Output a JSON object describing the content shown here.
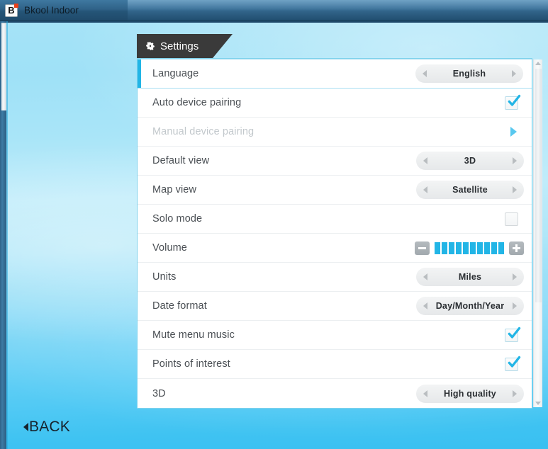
{
  "window": {
    "title": "Bkool Indoor",
    "logo_letter": "B",
    "logo_icon": "bkool-logo-icon"
  },
  "header": {
    "tab_label": "Settings",
    "tab_icon": "gear-icon"
  },
  "colors": {
    "accent_cyan": "#22b5e6",
    "tab_dark": "#3a3a3a",
    "panel_border": "#7fd2ec",
    "label_text": "#4a4f54",
    "disabled_text": "#c2c8cc",
    "sky_top": "#a5e3f7",
    "sky_bottom": "#39c0f1"
  },
  "settings": {
    "rows": [
      {
        "label": "Language",
        "control": "spinner",
        "value": "English",
        "selected": true,
        "disabled": false,
        "name": "setting-row-language"
      },
      {
        "label": "Auto device pairing",
        "control": "checkbox",
        "value": "checked",
        "selected": false,
        "disabled": false,
        "name": "setting-row-auto-device-pairing"
      },
      {
        "label": "Manual device pairing",
        "control": "arrow",
        "value": "",
        "selected": false,
        "disabled": true,
        "name": "setting-row-manual-device-pairing"
      },
      {
        "label": "Default view",
        "control": "spinner",
        "value": "3D",
        "selected": false,
        "disabled": false,
        "name": "setting-row-default-view"
      },
      {
        "label": "Map view",
        "control": "spinner",
        "value": "Satellite",
        "selected": false,
        "disabled": false,
        "name": "setting-row-map-view"
      },
      {
        "label": "Solo mode",
        "control": "checkbox",
        "value": "unchecked",
        "selected": false,
        "disabled": false,
        "name": "setting-row-solo-mode"
      },
      {
        "label": "Volume",
        "control": "volume",
        "value": "10",
        "selected": false,
        "disabled": false,
        "name": "setting-row-volume"
      },
      {
        "label": "Units",
        "control": "spinner",
        "value": "Miles",
        "selected": false,
        "disabled": false,
        "name": "setting-row-units"
      },
      {
        "label": "Date format",
        "control": "spinner",
        "value": "Day/Month/Year",
        "selected": false,
        "disabled": false,
        "name": "setting-row-date-format"
      },
      {
        "label": "Mute menu music",
        "control": "checkbox",
        "value": "checked",
        "selected": false,
        "disabled": false,
        "name": "setting-row-mute-menu-music"
      },
      {
        "label": "Points of interest",
        "control": "checkbox",
        "value": "checked",
        "selected": false,
        "disabled": false,
        "name": "setting-row-points-of-interest"
      },
      {
        "label": "3D",
        "control": "spinner",
        "value": "High quality",
        "selected": false,
        "disabled": false,
        "name": "setting-row-3d"
      }
    ]
  },
  "volume": {
    "total_segments": 10,
    "filled_segments": 10,
    "decrease_label": "-",
    "increase_label": "+"
  },
  "footer": {
    "back_label": "BACK"
  }
}
